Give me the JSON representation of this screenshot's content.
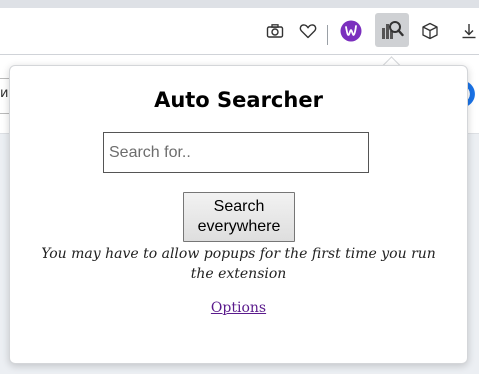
{
  "toolbar": {
    "icons": [
      {
        "name": "camera-icon"
      },
      {
        "name": "heart-icon"
      },
      {
        "name": "w-extension-icon",
        "color": "#7b2fbe"
      },
      {
        "name": "auto-searcher-extension-icon",
        "active": true
      },
      {
        "name": "cube-icon"
      },
      {
        "name": "download-icon"
      }
    ]
  },
  "page": {
    "left_fragment": "и"
  },
  "popup": {
    "title": "Auto Searcher",
    "search_placeholder": "Search for..",
    "search_value": "",
    "button_label_line1": "Search",
    "button_label_line2": "everywhere",
    "note": "You may have to allow popups for the first time you run the extension",
    "options_link": "Options"
  },
  "colors": {
    "link": "#5a1a8c",
    "w_extension": "#7b2fbe",
    "page_accent": "#1a73e8"
  }
}
